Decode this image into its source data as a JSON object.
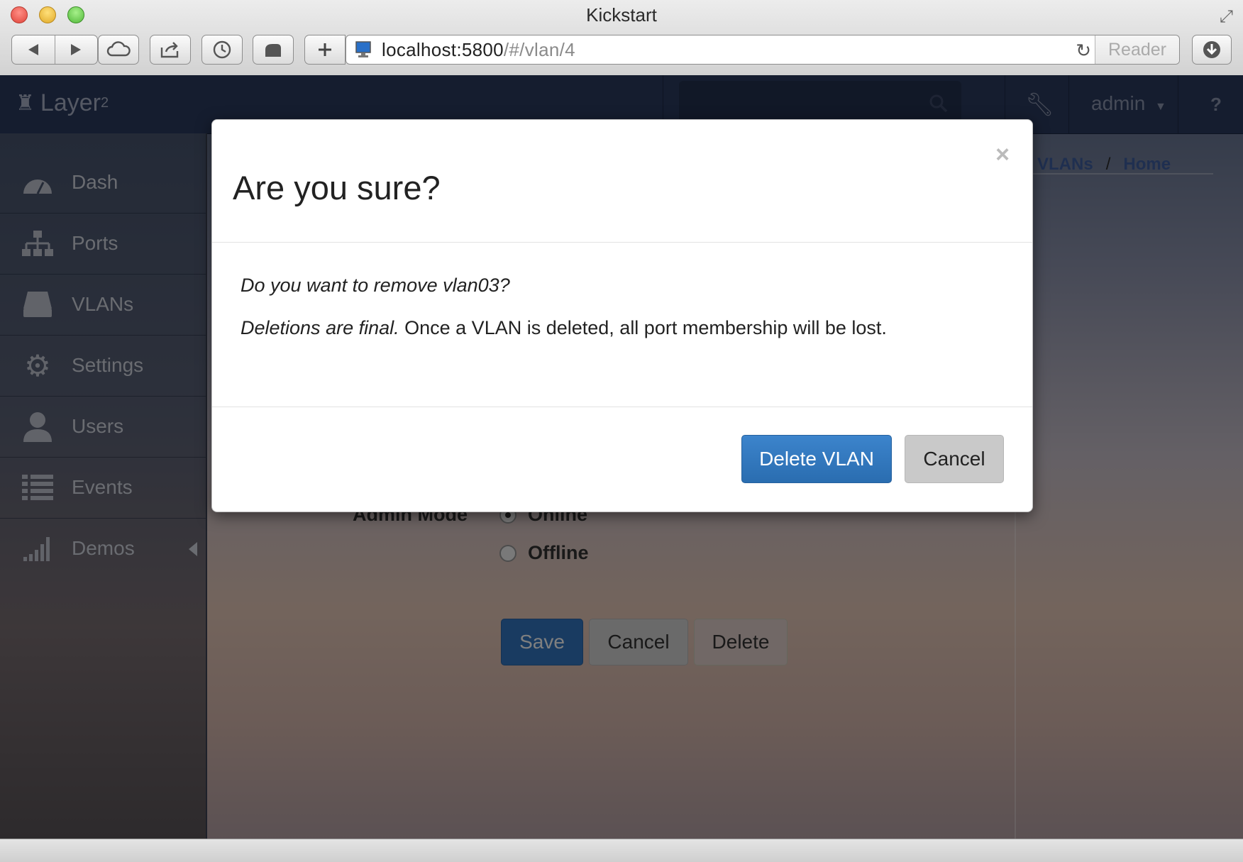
{
  "browser": {
    "window_title": "Kickstart",
    "url_host": "localhost:5800",
    "url_path": "/#/vlan/4",
    "reader_label": "Reader"
  },
  "navbar": {
    "brand": "Layer",
    "brand_sup": "2",
    "user": "admin",
    "help": "?"
  },
  "sidebar": {
    "items": [
      {
        "label": "Dash",
        "icon": "dashboard-icon"
      },
      {
        "label": "Ports",
        "icon": "sitemap-icon"
      },
      {
        "label": "VLANs",
        "icon": "hdd-icon"
      },
      {
        "label": "Settings",
        "icon": "gear-icon"
      },
      {
        "label": "Users",
        "icon": "user-icon"
      },
      {
        "label": "Events",
        "icon": "list-icon"
      },
      {
        "label": "Demos",
        "icon": "signal-icon"
      }
    ]
  },
  "breadcrumb": {
    "items": [
      "VLANs",
      "Home"
    ],
    "separator": "/"
  },
  "form": {
    "admin_mode_label": "Admin Mode",
    "options": [
      "Online",
      "Offline"
    ],
    "selected": "Online",
    "save_label": "Save",
    "cancel_label": "Cancel",
    "delete_label": "Delete"
  },
  "modal": {
    "close": "×",
    "title": "Are you sure?",
    "question": "Do you want to remove vlan03?",
    "warning_em": "Deletions are final.",
    "warning_rest": " Once a VLAN is deleted, all port membership will be lost.",
    "confirm_label": "Delete VLAN",
    "cancel_label": "Cancel"
  },
  "colors": {
    "primary": "#3277c3",
    "navbar": "#2b3b5e",
    "link": "#3e5fa0"
  }
}
